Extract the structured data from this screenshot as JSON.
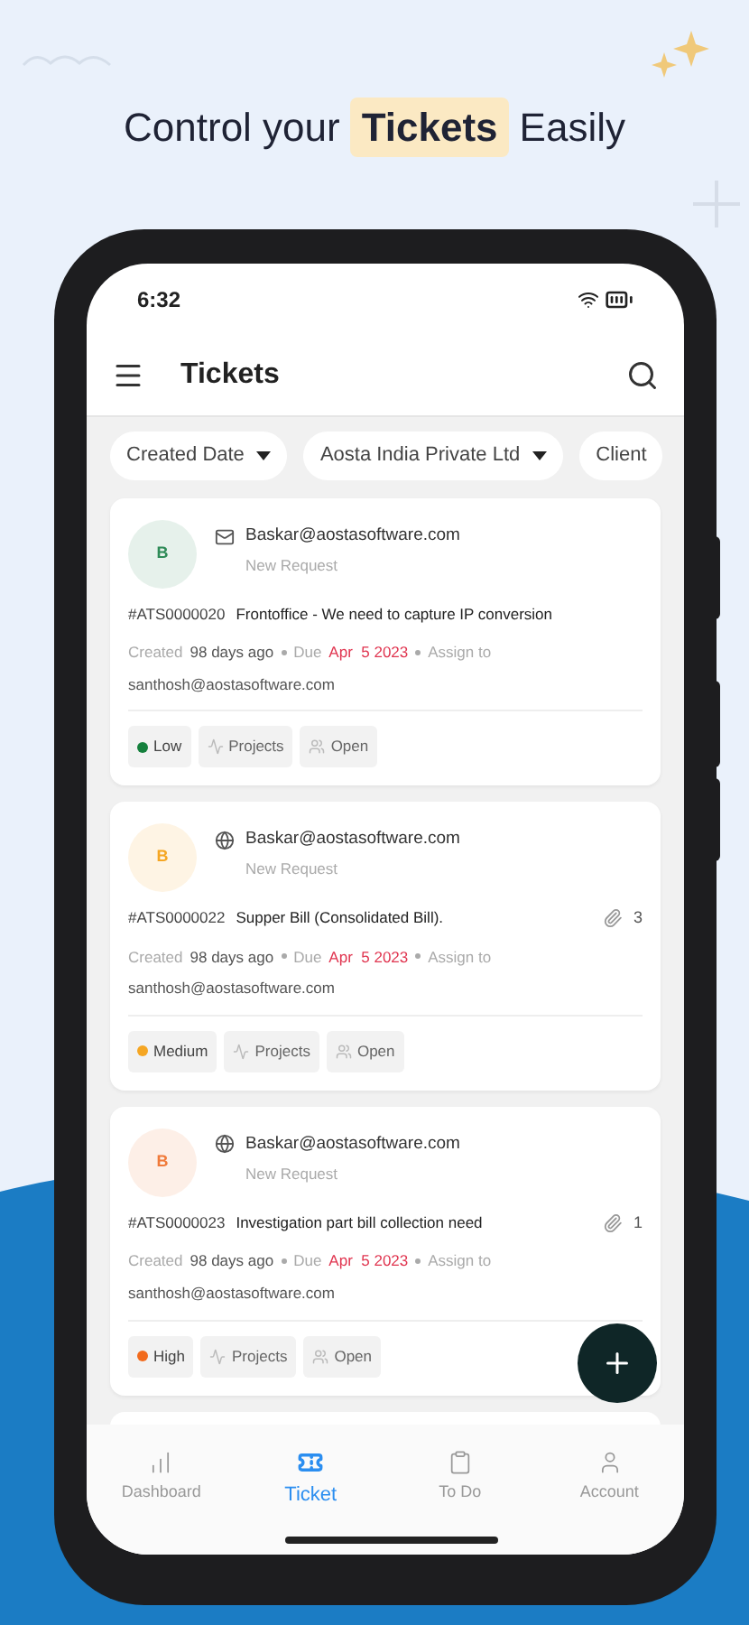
{
  "headline": {
    "before": "Control your",
    "highlight": "Tickets",
    "after": "Easily"
  },
  "status_bar": {
    "time": "6:32"
  },
  "app_bar": {
    "title": "Tickets"
  },
  "filters": [
    {
      "label": "Created Date",
      "dropdown": true
    },
    {
      "label": "Aosta India Private Ltd",
      "dropdown": true
    },
    {
      "label": "Client",
      "dropdown": false
    }
  ],
  "tickets": [
    {
      "avatar": "B",
      "color": "#2e8b57",
      "kind": "email",
      "email": "Baskar@aostasoftware.com",
      "type": "New Request",
      "id": "#ATS0000020",
      "title": "Frontoffice - We need to capture IP conversion",
      "created_label": "Created",
      "created": "98 days ago",
      "due_label": "Due",
      "due": "Apr  5 2023",
      "assign_label": "Assign to",
      "assignee": "santhosh@aostasoftware.com",
      "priority": {
        "label": "Low",
        "color": "#15803d"
      },
      "category": "Projects",
      "status": "Open"
    },
    {
      "avatar": "B",
      "color": "#f5a623",
      "kind": "web",
      "email": "Baskar@aostasoftware.com",
      "type": "New Request",
      "id": "#ATS0000022",
      "title": "Supper Bill (Consolidated Bill).",
      "attachments": "3",
      "created_label": "Created",
      "created": "98 days ago",
      "due_label": "Due",
      "due": "Apr  5 2023",
      "assign_label": "Assign to",
      "assignee": "santhosh@aostasoftware.com",
      "priority": {
        "label": "Medium",
        "color": "#f5a623"
      },
      "category": "Projects",
      "status": "Open"
    },
    {
      "avatar": "B",
      "color": "#f07a3a",
      "kind": "web",
      "email": "Baskar@aostasoftware.com",
      "type": "New Request",
      "id": "#ATS0000023",
      "title": "Investigation part bill collection need",
      "attachments": "1",
      "created_label": "Created",
      "created": "98 days ago",
      "due_label": "Due",
      "due": "Apr  5 2023",
      "assign_label": "Assign to",
      "assignee": "santhosh@aostasoftware.com",
      "priority": {
        "label": "High",
        "color": "#f26b1d"
      },
      "category": "Projects",
      "status": "Open"
    }
  ],
  "bottom_nav": [
    {
      "label": "Dashboard",
      "selected": false
    },
    {
      "label": "Ticket",
      "selected": true
    },
    {
      "label": "To Do",
      "selected": false
    },
    {
      "label": "Account",
      "selected": false
    }
  ]
}
